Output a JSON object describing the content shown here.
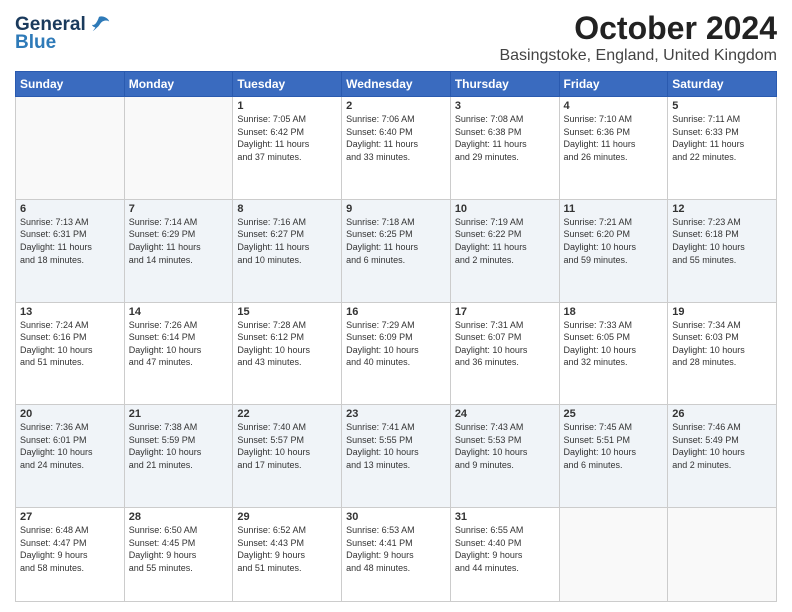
{
  "header": {
    "logo_line1": "General",
    "logo_line2": "Blue",
    "month_title": "October 2024",
    "location": "Basingstoke, England, United Kingdom"
  },
  "weekdays": [
    "Sunday",
    "Monday",
    "Tuesday",
    "Wednesday",
    "Thursday",
    "Friday",
    "Saturday"
  ],
  "weeks": [
    [
      {
        "day": "",
        "info": ""
      },
      {
        "day": "",
        "info": ""
      },
      {
        "day": "1",
        "info": "Sunrise: 7:05 AM\nSunset: 6:42 PM\nDaylight: 11 hours\nand 37 minutes."
      },
      {
        "day": "2",
        "info": "Sunrise: 7:06 AM\nSunset: 6:40 PM\nDaylight: 11 hours\nand 33 minutes."
      },
      {
        "day": "3",
        "info": "Sunrise: 7:08 AM\nSunset: 6:38 PM\nDaylight: 11 hours\nand 29 minutes."
      },
      {
        "day": "4",
        "info": "Sunrise: 7:10 AM\nSunset: 6:36 PM\nDaylight: 11 hours\nand 26 minutes."
      },
      {
        "day": "5",
        "info": "Sunrise: 7:11 AM\nSunset: 6:33 PM\nDaylight: 11 hours\nand 22 minutes."
      }
    ],
    [
      {
        "day": "6",
        "info": "Sunrise: 7:13 AM\nSunset: 6:31 PM\nDaylight: 11 hours\nand 18 minutes."
      },
      {
        "day": "7",
        "info": "Sunrise: 7:14 AM\nSunset: 6:29 PM\nDaylight: 11 hours\nand 14 minutes."
      },
      {
        "day": "8",
        "info": "Sunrise: 7:16 AM\nSunset: 6:27 PM\nDaylight: 11 hours\nand 10 minutes."
      },
      {
        "day": "9",
        "info": "Sunrise: 7:18 AM\nSunset: 6:25 PM\nDaylight: 11 hours\nand 6 minutes."
      },
      {
        "day": "10",
        "info": "Sunrise: 7:19 AM\nSunset: 6:22 PM\nDaylight: 11 hours\nand 2 minutes."
      },
      {
        "day": "11",
        "info": "Sunrise: 7:21 AM\nSunset: 6:20 PM\nDaylight: 10 hours\nand 59 minutes."
      },
      {
        "day": "12",
        "info": "Sunrise: 7:23 AM\nSunset: 6:18 PM\nDaylight: 10 hours\nand 55 minutes."
      }
    ],
    [
      {
        "day": "13",
        "info": "Sunrise: 7:24 AM\nSunset: 6:16 PM\nDaylight: 10 hours\nand 51 minutes."
      },
      {
        "day": "14",
        "info": "Sunrise: 7:26 AM\nSunset: 6:14 PM\nDaylight: 10 hours\nand 47 minutes."
      },
      {
        "day": "15",
        "info": "Sunrise: 7:28 AM\nSunset: 6:12 PM\nDaylight: 10 hours\nand 43 minutes."
      },
      {
        "day": "16",
        "info": "Sunrise: 7:29 AM\nSunset: 6:09 PM\nDaylight: 10 hours\nand 40 minutes."
      },
      {
        "day": "17",
        "info": "Sunrise: 7:31 AM\nSunset: 6:07 PM\nDaylight: 10 hours\nand 36 minutes."
      },
      {
        "day": "18",
        "info": "Sunrise: 7:33 AM\nSunset: 6:05 PM\nDaylight: 10 hours\nand 32 minutes."
      },
      {
        "day": "19",
        "info": "Sunrise: 7:34 AM\nSunset: 6:03 PM\nDaylight: 10 hours\nand 28 minutes."
      }
    ],
    [
      {
        "day": "20",
        "info": "Sunrise: 7:36 AM\nSunset: 6:01 PM\nDaylight: 10 hours\nand 24 minutes."
      },
      {
        "day": "21",
        "info": "Sunrise: 7:38 AM\nSunset: 5:59 PM\nDaylight: 10 hours\nand 21 minutes."
      },
      {
        "day": "22",
        "info": "Sunrise: 7:40 AM\nSunset: 5:57 PM\nDaylight: 10 hours\nand 17 minutes."
      },
      {
        "day": "23",
        "info": "Sunrise: 7:41 AM\nSunset: 5:55 PM\nDaylight: 10 hours\nand 13 minutes."
      },
      {
        "day": "24",
        "info": "Sunrise: 7:43 AM\nSunset: 5:53 PM\nDaylight: 10 hours\nand 9 minutes."
      },
      {
        "day": "25",
        "info": "Sunrise: 7:45 AM\nSunset: 5:51 PM\nDaylight: 10 hours\nand 6 minutes."
      },
      {
        "day": "26",
        "info": "Sunrise: 7:46 AM\nSunset: 5:49 PM\nDaylight: 10 hours\nand 2 minutes."
      }
    ],
    [
      {
        "day": "27",
        "info": "Sunrise: 6:48 AM\nSunset: 4:47 PM\nDaylight: 9 hours\nand 58 minutes."
      },
      {
        "day": "28",
        "info": "Sunrise: 6:50 AM\nSunset: 4:45 PM\nDaylight: 9 hours\nand 55 minutes."
      },
      {
        "day": "29",
        "info": "Sunrise: 6:52 AM\nSunset: 4:43 PM\nDaylight: 9 hours\nand 51 minutes."
      },
      {
        "day": "30",
        "info": "Sunrise: 6:53 AM\nSunset: 4:41 PM\nDaylight: 9 hours\nand 48 minutes."
      },
      {
        "day": "31",
        "info": "Sunrise: 6:55 AM\nSunset: 4:40 PM\nDaylight: 9 hours\nand 44 minutes."
      },
      {
        "day": "",
        "info": ""
      },
      {
        "day": "",
        "info": ""
      }
    ]
  ]
}
